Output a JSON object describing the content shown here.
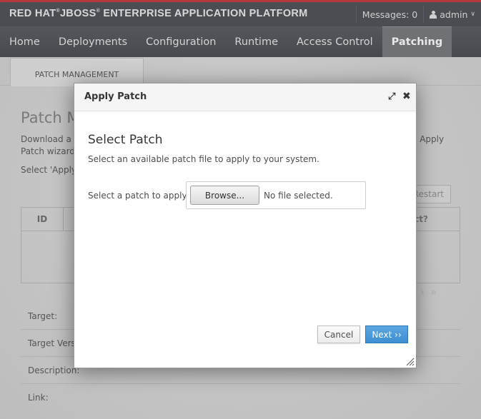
{
  "header": {
    "brand_part1": "RED HAT",
    "brand_mark1": "®",
    "brand_part2": "JBOSS",
    "brand_mark2": "®",
    "brand_part3": " ENTERPRISE APPLICATION PLATFORM",
    "messages": "Messages: 0",
    "user": "admin",
    "accent_color": "#b5383b"
  },
  "nav": {
    "tabs": [
      {
        "label": "Home"
      },
      {
        "label": "Deployments"
      },
      {
        "label": "Configuration"
      },
      {
        "label": "Runtime"
      },
      {
        "label": "Access Control"
      },
      {
        "label": "Patching",
        "active": true
      }
    ]
  },
  "page": {
    "subtab": "PATCH MANAGEMENT",
    "title": "Patch M",
    "desc_line1": "Download a p",
    "desc_line1_right": "e Apply",
    "desc_line2": "Patch wizard",
    "desc_instruction": "Select 'Apply",
    "restart_button": "Restart",
    "table": {
      "col_id": "ID",
      "col_right": "ct?"
    },
    "pager": {
      "next": "›",
      "last": "»"
    },
    "details": [
      {
        "label": "Target:"
      },
      {
        "label": "Target Vers"
      },
      {
        "label": "Description:"
      },
      {
        "label": "Link:"
      }
    ]
  },
  "modal": {
    "title": "Apply Patch",
    "maximize_glyph": "⤢",
    "close_glyph": "✖",
    "step_title": "Select Patch",
    "step_description": "Select an available patch file to apply to your system.",
    "field_label": "Select a patch to apply",
    "browse_label": "Browse...",
    "file_status": "No file selected.",
    "cancel_label": "Cancel",
    "next_label": "Next ››",
    "primary_color": "#4a97d6"
  }
}
